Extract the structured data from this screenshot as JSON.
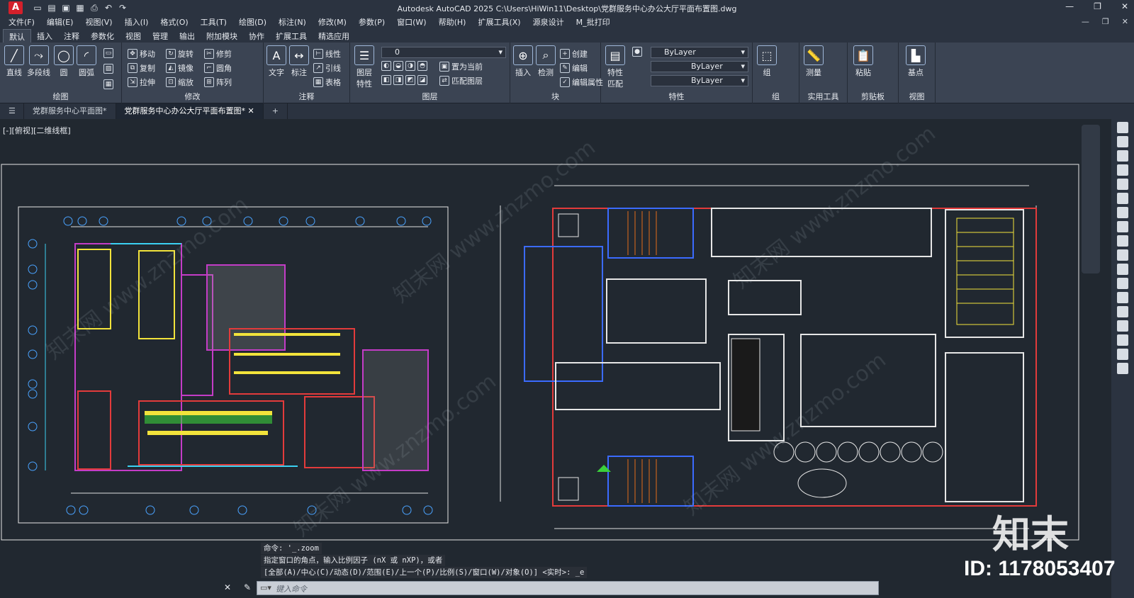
{
  "app": {
    "logo": "A",
    "title": "Autodesk AutoCAD 2025    C:\\Users\\HiWin11\\Desktop\\党群服务中心办公大厅平面布置图.dwg"
  },
  "menu": [
    "文件(F)",
    "编辑(E)",
    "视图(V)",
    "插入(I)",
    "格式(O)",
    "工具(T)",
    "绘图(D)",
    "标注(N)",
    "修改(M)",
    "参数(P)",
    "窗口(W)",
    "帮助(H)",
    "扩展工具(X)",
    "源泉设计",
    "M_批打印"
  ],
  "ribbon_tabs": [
    "默认",
    "插入",
    "注释",
    "参数化",
    "视图",
    "管理",
    "输出",
    "附加模块",
    "协作",
    "扩展工具",
    "精选应用"
  ],
  "ribbon": {
    "draw": {
      "title": "绘图",
      "line": "直线",
      "polyline": "多段线",
      "circle": "圆",
      "arc": "圆弧"
    },
    "modify": {
      "title": "修改",
      "move": "移动",
      "rotate": "旋转",
      "trim": "修剪",
      "copy": "复制",
      "mirror": "镜像",
      "fillet": "圆角",
      "stretch": "拉伸",
      "scale": "缩放",
      "array": "阵列"
    },
    "annotation": {
      "title": "注释",
      "text": "文字",
      "dim": "标注",
      "linear": "线性",
      "leader": "引线",
      "table": "表格"
    },
    "layers": {
      "title": "图层",
      "props": "图层\n特性",
      "layer_value": "0",
      "set_current": "置为当前",
      "match": "匹配图层"
    },
    "block": {
      "title": "块",
      "insert": "插入",
      "edit": "检测",
      "create": "创建",
      "edit2": "编辑",
      "edit_attr": "编辑属性"
    },
    "properties": {
      "title": "特性",
      "match": "特性\n匹配",
      "color": "ByLayer",
      "linetype": "ByLayer",
      "lineweight": "ByLayer"
    },
    "group": {
      "title": "组",
      "label": "组"
    },
    "utilities": {
      "title": "实用工具",
      "measure": "测量"
    },
    "clipboard": {
      "title": "剪贴板",
      "paste": "粘贴"
    },
    "view": {
      "title": "视图",
      "base": "基点"
    }
  },
  "doc_tabs": [
    "党群服务中心平面图*",
    "党群服务中心办公大厅平面布置图*"
  ],
  "viewport_label": "[-][俯视][二维线框]",
  "command_history": [
    "命令: '_.zoom",
    "指定窗口的角点，输入比例因子 (nX 或 nXP)，或者",
    "[全部(A)/中心(C)/动态(D)/范围(E)/上一个(P)/比例(S)/窗口(W)/对象(O)] <实时>: _e"
  ],
  "command_placeholder": "键入命令",
  "watermark": {
    "logo": "知末",
    "id": "ID: 1178053407"
  }
}
